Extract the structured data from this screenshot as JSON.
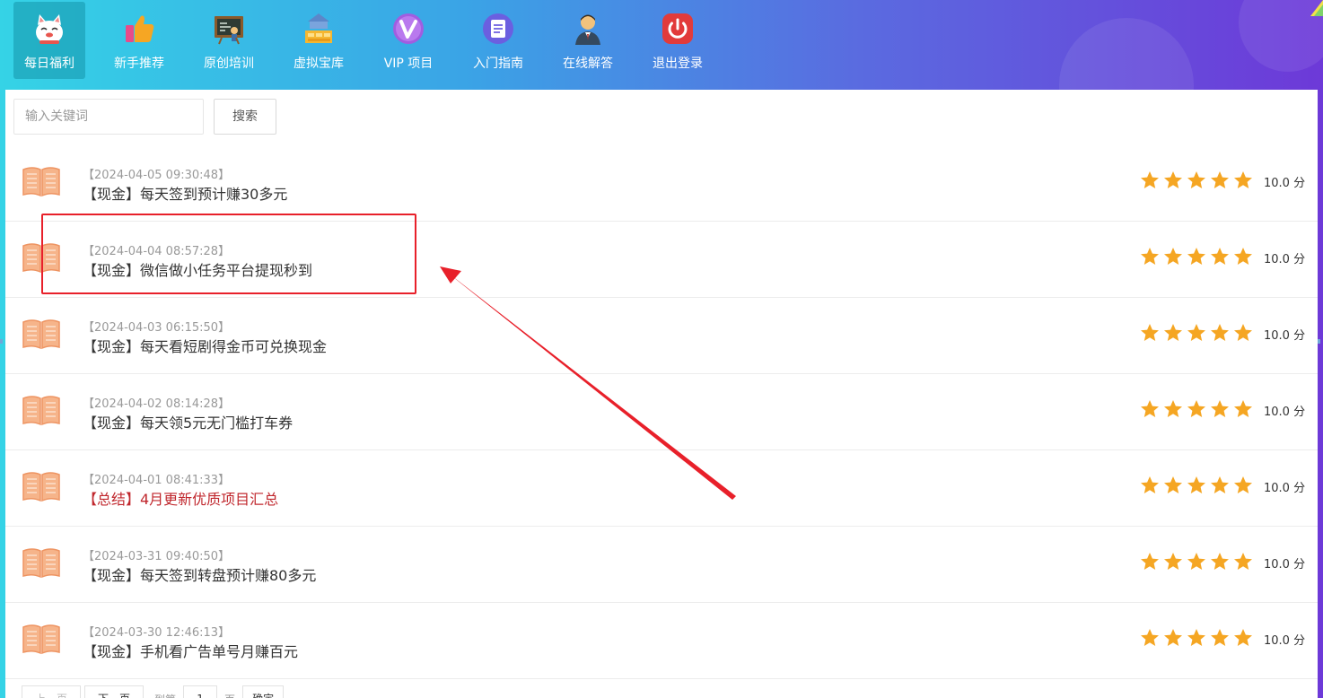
{
  "nav": {
    "items": [
      {
        "label": "每日福利",
        "icon": "lucky-cat-icon",
        "active": true
      },
      {
        "label": "新手推荐",
        "icon": "thumbs-up-icon",
        "active": false
      },
      {
        "label": "原创培训",
        "icon": "blackboard-icon",
        "active": false
      },
      {
        "label": "虚拟宝库",
        "icon": "treasure-building-icon",
        "active": false
      },
      {
        "label": "VIP 项目",
        "icon": "vip-icon",
        "active": false
      },
      {
        "label": "入门指南",
        "icon": "document-icon",
        "active": false
      },
      {
        "label": "在线解答",
        "icon": "support-agent-icon",
        "active": false
      },
      {
        "label": "退出登录",
        "icon": "power-icon",
        "active": false
      }
    ]
  },
  "search": {
    "placeholder": "输入关键词",
    "value": "",
    "button_label": "搜索"
  },
  "articles": [
    {
      "date": "【2024-04-05 09:30:48】",
      "title": "【现金】每天签到预计赚30多元",
      "highlight": false,
      "rating": 5,
      "score": "10.0 分"
    },
    {
      "date": "【2024-04-04 08:57:28】",
      "title": "【现金】微信做小任务平台提现秒到",
      "highlight": false,
      "rating": 5,
      "score": "10.0 分"
    },
    {
      "date": "【2024-04-03 06:15:50】",
      "title": "【现金】每天看短剧得金币可兑换现金",
      "highlight": false,
      "rating": 5,
      "score": "10.0 分"
    },
    {
      "date": "【2024-04-02 08:14:28】",
      "title": "【现金】每天领5元无门槛打车券",
      "highlight": false,
      "rating": 5,
      "score": "10.0 分"
    },
    {
      "date": "【2024-04-01 08:41:33】",
      "title": "【总结】4月更新优质项目汇总",
      "highlight": true,
      "rating": 5,
      "score": "10.0 分"
    },
    {
      "date": "【2024-03-31 09:40:50】",
      "title": "【现金】每天签到转盘预计赚80多元",
      "highlight": false,
      "rating": 5,
      "score": "10.0 分"
    },
    {
      "date": "【2024-03-30 12:46:13】",
      "title": "【现金】手机看广告单号月赚百元",
      "highlight": false,
      "rating": 5,
      "score": "10.0 分"
    }
  ],
  "pagination": {
    "prev_label": "上一页",
    "next_label": "下一页",
    "goto_label": "到第",
    "page_value": "1",
    "page_unit": "页",
    "confirm_label": "确定"
  },
  "colors": {
    "accent_red": "#c0272d",
    "star": "#f5a623",
    "annotation": "#e8202a"
  }
}
